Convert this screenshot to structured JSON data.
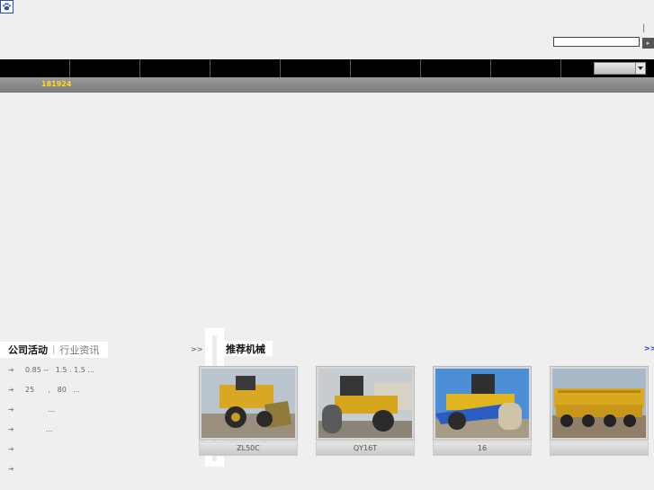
{
  "header": {
    "logo_icon": "paw-icon",
    "separator": "|",
    "search": {
      "value": "",
      "button_glyph": "▸"
    }
  },
  "nav": {
    "item_count": 8,
    "select_value": ""
  },
  "subbar": {
    "phone": "181924"
  },
  "news": {
    "tabs": [
      "公司活动",
      "行业资讯"
    ],
    "tab_separator": "|",
    "more": ">>",
    "items": [
      {
        "text": "0.85 --   1.5 . 1.5 ..."
      },
      {
        "text": "25      ,   80   ..."
      },
      {
        "text": "          ..."
      },
      {
        "text": "         ..."
      },
      {
        "text": ""
      },
      {
        "text": ""
      }
    ]
  },
  "recommended": {
    "title": "推荐机械",
    "more": ">>",
    "cards": [
      {
        "caption": "ZL50C",
        "subject": "wheel-loader"
      },
      {
        "caption": "QY16T",
        "subject": "road-roller"
      },
      {
        "caption": "16",
        "subject": "road-roller"
      },
      {
        "caption": "",
        "subject": "truck-crane"
      }
    ]
  },
  "colors": {
    "nav_bg": "#000000",
    "subbar_bg": "#8a8a8a",
    "phone_text": "#ffdd22",
    "machine_yellow": "#e2b420",
    "sky_blue": "#4c8fd6"
  }
}
